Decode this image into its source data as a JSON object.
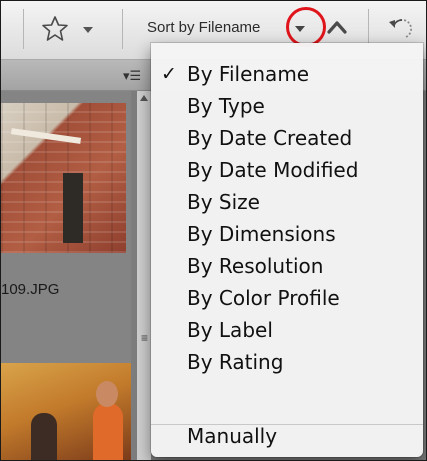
{
  "toolbar": {
    "sort_label": "Sort by Filename"
  },
  "thumbnails": {
    "filename": "109.JPG"
  },
  "sort_menu": {
    "selected_index": 0,
    "check_glyph": "✓",
    "items": [
      "By Filename",
      "By Type",
      "By Date Created",
      "By Date Modified",
      "By Size",
      "By Dimensions",
      "By Resolution",
      "By Color Profile",
      "By Label",
      "By Rating"
    ],
    "manual_item": "Manually"
  },
  "icons": {
    "star": "star-icon",
    "dropdown": "chevron-down-icon",
    "ascending": "chevron-up-icon",
    "rotate": "rotate-icon",
    "list": "list-view-icon"
  },
  "colors": {
    "highlight_circle": "#e0141b",
    "checkmark": "#111111"
  }
}
